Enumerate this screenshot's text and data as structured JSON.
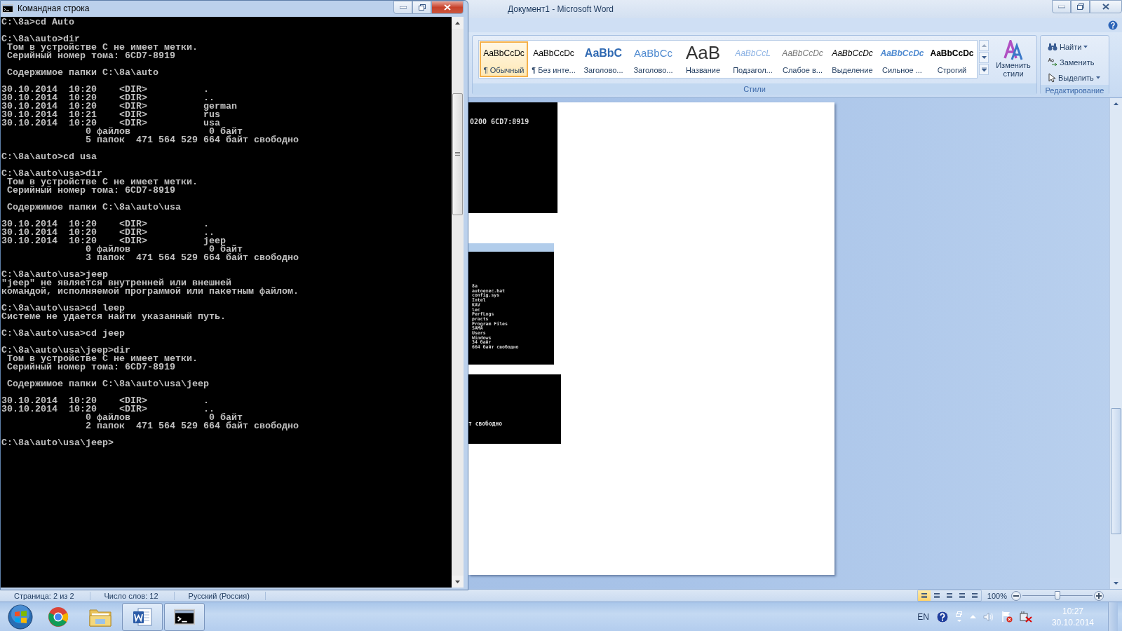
{
  "console_window": {
    "title": "Командная строка",
    "blocks": [
      [
        "C:\\8a>cd Auto"
      ],
      [
        "C:\\8a\\auto>dir",
        " Том в устройстве C не имеет метки.",
        " Серийный номер тома: 6CD7-8919"
      ],
      [
        " Содержимое папки C:\\8a\\auto"
      ],
      [
        "30.10.2014  10:20    <DIR>          .",
        "30.10.2014  10:20    <DIR>          ..",
        "30.10.2014  10:20    <DIR>          german",
        "30.10.2014  10:21    <DIR>          rus",
        "30.10.2014  10:20    <DIR>          usa",
        "               0 файлов              0 байт",
        "               5 папок  471 564 529 664 байт свободно"
      ],
      [
        "C:\\8a\\auto>cd usa"
      ],
      [
        "C:\\8a\\auto\\usa>dir",
        " Том в устройстве C не имеет метки.",
        " Серийный номер тома: 6CD7-8919"
      ],
      [
        " Содержимое папки C:\\8a\\auto\\usa"
      ],
      [
        "30.10.2014  10:20    <DIR>          .",
        "30.10.2014  10:20    <DIR>          ..",
        "30.10.2014  10:20    <DIR>          jeep",
        "               0 файлов              0 байт",
        "               3 папок  471 564 529 664 байт свободно"
      ],
      [
        "C:\\8a\\auto\\usa>jeep",
        "\"jeep\" не является внутренней или внешней",
        "командой, исполняемой программой или пакетным файлом."
      ],
      [
        "C:\\8a\\auto\\usa>cd leep",
        "Системе не удается найти указанный путь."
      ],
      [
        "C:\\8a\\auto\\usa>cd jeep"
      ],
      [
        "C:\\8a\\auto\\usa\\jeep>dir",
        " Том в устройстве C не имеет метки.",
        " Серийный номер тома: 6CD7-8919"
      ],
      [
        " Содержимое папки C:\\8a\\auto\\usa\\jeep"
      ],
      [
        "30.10.2014  10:20    <DIR>          .",
        "30.10.2014  10:20    <DIR>          ..",
        "               0 файлов              0 байт",
        "               2 папок  471 564 529 664 байт свободно"
      ],
      [
        "C:\\8a\\auto\\usa\\jeep>"
      ]
    ]
  },
  "word_window": {
    "title": "Документ1 - Microsoft Word",
    "styles": [
      {
        "kind": "normal",
        "sample": "AaBbCcDc",
        "label": "¶ Обычный",
        "selected": true
      },
      {
        "kind": "normal",
        "sample": "AaBbCcDc",
        "label": "¶ Без инте...",
        "selected": false
      },
      {
        "kind": "heading1",
        "sample": "AaBbC",
        "label": "Заголово...",
        "selected": false
      },
      {
        "kind": "heading2",
        "sample": "AaBbCc",
        "label": "Заголово...",
        "selected": false
      },
      {
        "kind": "title",
        "sample": "AaB",
        "label": "Название",
        "selected": false
      },
      {
        "kind": "subtitle",
        "sample": "AaBbCcL",
        "label": "Подзагол...",
        "selected": false
      },
      {
        "kind": "subtle",
        "sample": "AaBbCcDc",
        "label": "Слабое в...",
        "selected": false
      },
      {
        "kind": "emphasis",
        "sample": "AaBbCcDc",
        "label": "Выделение",
        "selected": false
      },
      {
        "kind": "intense",
        "sample": "AaBbCcDc",
        "label": "Сильное ...",
        "selected": false
      },
      {
        "kind": "strong",
        "sample": "AaBbCcDc",
        "label": "Строгий",
        "selected": false
      }
    ],
    "change_styles": "Изменить стили",
    "styles_group": "Стили",
    "editing": [
      {
        "kind": "find",
        "label": "Найти"
      },
      {
        "kind": "replace",
        "label": "Заменить"
      },
      {
        "kind": "select",
        "label": "Выделить"
      }
    ],
    "editing_group": "Редактирование",
    "document_images": [
      {
        "kind": "single",
        "lines": [
          "0200 6CD7:8919"
        ]
      },
      {
        "kind": "listing",
        "lines": [
          "8a",
          "autoexec.bat",
          "config.sys",
          "Intel",
          "KAV",
          "lec",
          "PerfLogs",
          "practs",
          "Program Files",
          "SAMA",
          "Users",
          "Windows",
          "34 байт",
          "664 байт свободно"
        ]
      },
      {
        "kind": "footer",
        "lines": [
          "т свободно"
        ]
      }
    ],
    "status_bar": {
      "items": [
        "Страница: 2 из 2",
        "Число слов: 12",
        "Русский (Россия)"
      ],
      "views": [
        {
          "selected": true
        },
        {
          "selected": false
        },
        {
          "selected": false
        },
        {
          "selected": false
        },
        {
          "selected": false
        }
      ],
      "zoom": "100%",
      "zoom_slider": {
        "level": 0.5
      }
    }
  },
  "taskbar": {
    "apps": [
      {
        "kind": "start",
        "running": false
      },
      {
        "kind": "browser",
        "running": false
      },
      {
        "kind": "folder",
        "running": false
      },
      {
        "kind": "word",
        "running": true
      },
      {
        "kind": "console",
        "running": true
      }
    ],
    "language": "EN",
    "time": "10:27",
    "date": "30.10.2014"
  }
}
